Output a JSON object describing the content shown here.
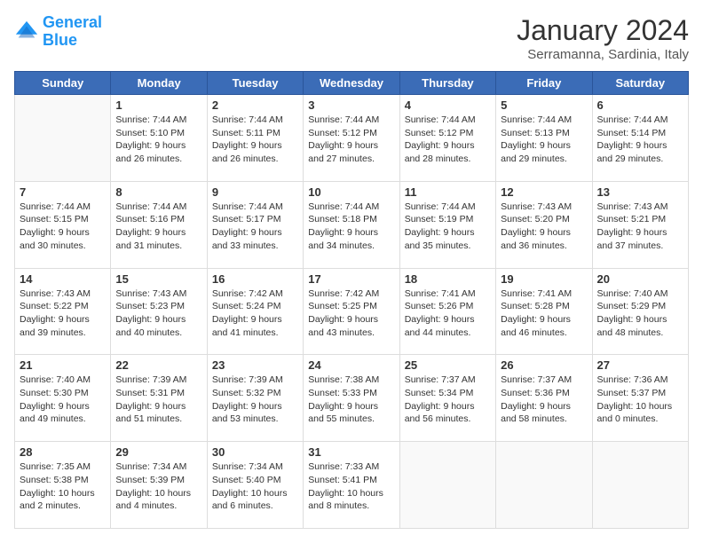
{
  "header": {
    "logo_line1": "General",
    "logo_line2": "Blue",
    "month_title": "January 2024",
    "location": "Serramanna, Sardinia, Italy"
  },
  "days_of_week": [
    "Sunday",
    "Monday",
    "Tuesday",
    "Wednesday",
    "Thursday",
    "Friday",
    "Saturday"
  ],
  "weeks": [
    [
      {
        "day": "",
        "empty": true
      },
      {
        "day": "1",
        "sunrise": "Sunrise: 7:44 AM",
        "sunset": "Sunset: 5:10 PM",
        "daylight": "Daylight: 9 hours and 26 minutes."
      },
      {
        "day": "2",
        "sunrise": "Sunrise: 7:44 AM",
        "sunset": "Sunset: 5:11 PM",
        "daylight": "Daylight: 9 hours and 26 minutes."
      },
      {
        "day": "3",
        "sunrise": "Sunrise: 7:44 AM",
        "sunset": "Sunset: 5:12 PM",
        "daylight": "Daylight: 9 hours and 27 minutes."
      },
      {
        "day": "4",
        "sunrise": "Sunrise: 7:44 AM",
        "sunset": "Sunset: 5:12 PM",
        "daylight": "Daylight: 9 hours and 28 minutes."
      },
      {
        "day": "5",
        "sunrise": "Sunrise: 7:44 AM",
        "sunset": "Sunset: 5:13 PM",
        "daylight": "Daylight: 9 hours and 29 minutes."
      },
      {
        "day": "6",
        "sunrise": "Sunrise: 7:44 AM",
        "sunset": "Sunset: 5:14 PM",
        "daylight": "Daylight: 9 hours and 29 minutes."
      }
    ],
    [
      {
        "day": "7",
        "sunrise": "Sunrise: 7:44 AM",
        "sunset": "Sunset: 5:15 PM",
        "daylight": "Daylight: 9 hours and 30 minutes."
      },
      {
        "day": "8",
        "sunrise": "Sunrise: 7:44 AM",
        "sunset": "Sunset: 5:16 PM",
        "daylight": "Daylight: 9 hours and 31 minutes."
      },
      {
        "day": "9",
        "sunrise": "Sunrise: 7:44 AM",
        "sunset": "Sunset: 5:17 PM",
        "daylight": "Daylight: 9 hours and 33 minutes."
      },
      {
        "day": "10",
        "sunrise": "Sunrise: 7:44 AM",
        "sunset": "Sunset: 5:18 PM",
        "daylight": "Daylight: 9 hours and 34 minutes."
      },
      {
        "day": "11",
        "sunrise": "Sunrise: 7:44 AM",
        "sunset": "Sunset: 5:19 PM",
        "daylight": "Daylight: 9 hours and 35 minutes."
      },
      {
        "day": "12",
        "sunrise": "Sunrise: 7:43 AM",
        "sunset": "Sunset: 5:20 PM",
        "daylight": "Daylight: 9 hours and 36 minutes."
      },
      {
        "day": "13",
        "sunrise": "Sunrise: 7:43 AM",
        "sunset": "Sunset: 5:21 PM",
        "daylight": "Daylight: 9 hours and 37 minutes."
      }
    ],
    [
      {
        "day": "14",
        "sunrise": "Sunrise: 7:43 AM",
        "sunset": "Sunset: 5:22 PM",
        "daylight": "Daylight: 9 hours and 39 minutes."
      },
      {
        "day": "15",
        "sunrise": "Sunrise: 7:43 AM",
        "sunset": "Sunset: 5:23 PM",
        "daylight": "Daylight: 9 hours and 40 minutes."
      },
      {
        "day": "16",
        "sunrise": "Sunrise: 7:42 AM",
        "sunset": "Sunset: 5:24 PM",
        "daylight": "Daylight: 9 hours and 41 minutes."
      },
      {
        "day": "17",
        "sunrise": "Sunrise: 7:42 AM",
        "sunset": "Sunset: 5:25 PM",
        "daylight": "Daylight: 9 hours and 43 minutes."
      },
      {
        "day": "18",
        "sunrise": "Sunrise: 7:41 AM",
        "sunset": "Sunset: 5:26 PM",
        "daylight": "Daylight: 9 hours and 44 minutes."
      },
      {
        "day": "19",
        "sunrise": "Sunrise: 7:41 AM",
        "sunset": "Sunset: 5:28 PM",
        "daylight": "Daylight: 9 hours and 46 minutes."
      },
      {
        "day": "20",
        "sunrise": "Sunrise: 7:40 AM",
        "sunset": "Sunset: 5:29 PM",
        "daylight": "Daylight: 9 hours and 48 minutes."
      }
    ],
    [
      {
        "day": "21",
        "sunrise": "Sunrise: 7:40 AM",
        "sunset": "Sunset: 5:30 PM",
        "daylight": "Daylight: 9 hours and 49 minutes."
      },
      {
        "day": "22",
        "sunrise": "Sunrise: 7:39 AM",
        "sunset": "Sunset: 5:31 PM",
        "daylight": "Daylight: 9 hours and 51 minutes."
      },
      {
        "day": "23",
        "sunrise": "Sunrise: 7:39 AM",
        "sunset": "Sunset: 5:32 PM",
        "daylight": "Daylight: 9 hours and 53 minutes."
      },
      {
        "day": "24",
        "sunrise": "Sunrise: 7:38 AM",
        "sunset": "Sunset: 5:33 PM",
        "daylight": "Daylight: 9 hours and 55 minutes."
      },
      {
        "day": "25",
        "sunrise": "Sunrise: 7:37 AM",
        "sunset": "Sunset: 5:34 PM",
        "daylight": "Daylight: 9 hours and 56 minutes."
      },
      {
        "day": "26",
        "sunrise": "Sunrise: 7:37 AM",
        "sunset": "Sunset: 5:36 PM",
        "daylight": "Daylight: 9 hours and 58 minutes."
      },
      {
        "day": "27",
        "sunrise": "Sunrise: 7:36 AM",
        "sunset": "Sunset: 5:37 PM",
        "daylight": "Daylight: 10 hours and 0 minutes."
      }
    ],
    [
      {
        "day": "28",
        "sunrise": "Sunrise: 7:35 AM",
        "sunset": "Sunset: 5:38 PM",
        "daylight": "Daylight: 10 hours and 2 minutes."
      },
      {
        "day": "29",
        "sunrise": "Sunrise: 7:34 AM",
        "sunset": "Sunset: 5:39 PM",
        "daylight": "Daylight: 10 hours and 4 minutes."
      },
      {
        "day": "30",
        "sunrise": "Sunrise: 7:34 AM",
        "sunset": "Sunset: 5:40 PM",
        "daylight": "Daylight: 10 hours and 6 minutes."
      },
      {
        "day": "31",
        "sunrise": "Sunrise: 7:33 AM",
        "sunset": "Sunset: 5:41 PM",
        "daylight": "Daylight: 10 hours and 8 minutes."
      },
      {
        "day": "",
        "empty": true
      },
      {
        "day": "",
        "empty": true
      },
      {
        "day": "",
        "empty": true
      }
    ]
  ]
}
